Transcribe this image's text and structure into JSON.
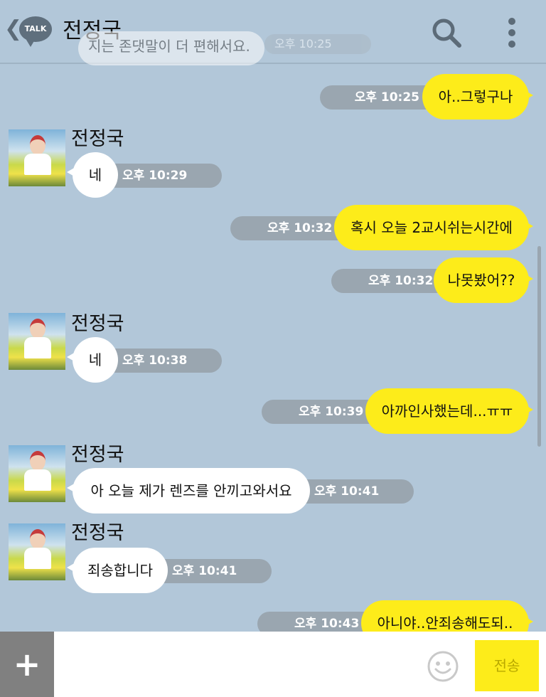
{
  "header": {
    "back_glyph": "❮",
    "logo": "TALK",
    "title": "전정국"
  },
  "ghost": {
    "text": "지는 존댓말이 더 편해서요.",
    "time": "오후 10:25"
  },
  "messages": [
    {
      "dir": "out",
      "text": "아..그렇구나",
      "time": "오후 10:25"
    },
    {
      "dir": "in",
      "name": "전정국",
      "text": "네",
      "time": "오후 10:29"
    },
    {
      "dir": "out",
      "text": "혹시 오늘 2교시쉬는시간에",
      "time": "오후 10:32"
    },
    {
      "dir": "out",
      "text": "나못봤어??",
      "time": "오후 10:32"
    },
    {
      "dir": "in",
      "name": "전정국",
      "text": "네",
      "time": "오후 10:38"
    },
    {
      "dir": "out",
      "text": "아까인사했는데...ㅠㅠ",
      "time": "오후 10:39"
    },
    {
      "dir": "in",
      "name": "전정국",
      "text": "아 오늘 제가 렌즈를 안끼고와서요",
      "time": "오후 10:41"
    },
    {
      "dir": "in",
      "name": "전정국",
      "text": "죄송합니다",
      "time": "오후 10:41"
    },
    {
      "dir": "out",
      "text": "아니야..안죄송해도되..",
      "time": "오후 10:43"
    }
  ],
  "input": {
    "plus": "+",
    "placeholder": "",
    "send_label": "전송"
  },
  "colors": {
    "background": "#b2c7d9",
    "outgoing_bubble": "#fdec1a",
    "incoming_bubble": "#ffffff",
    "time_pill": "#9aa6b0"
  },
  "icons": [
    "talk-logo",
    "search-icon",
    "more-vert-icon",
    "plus-icon",
    "emoji-icon"
  ]
}
